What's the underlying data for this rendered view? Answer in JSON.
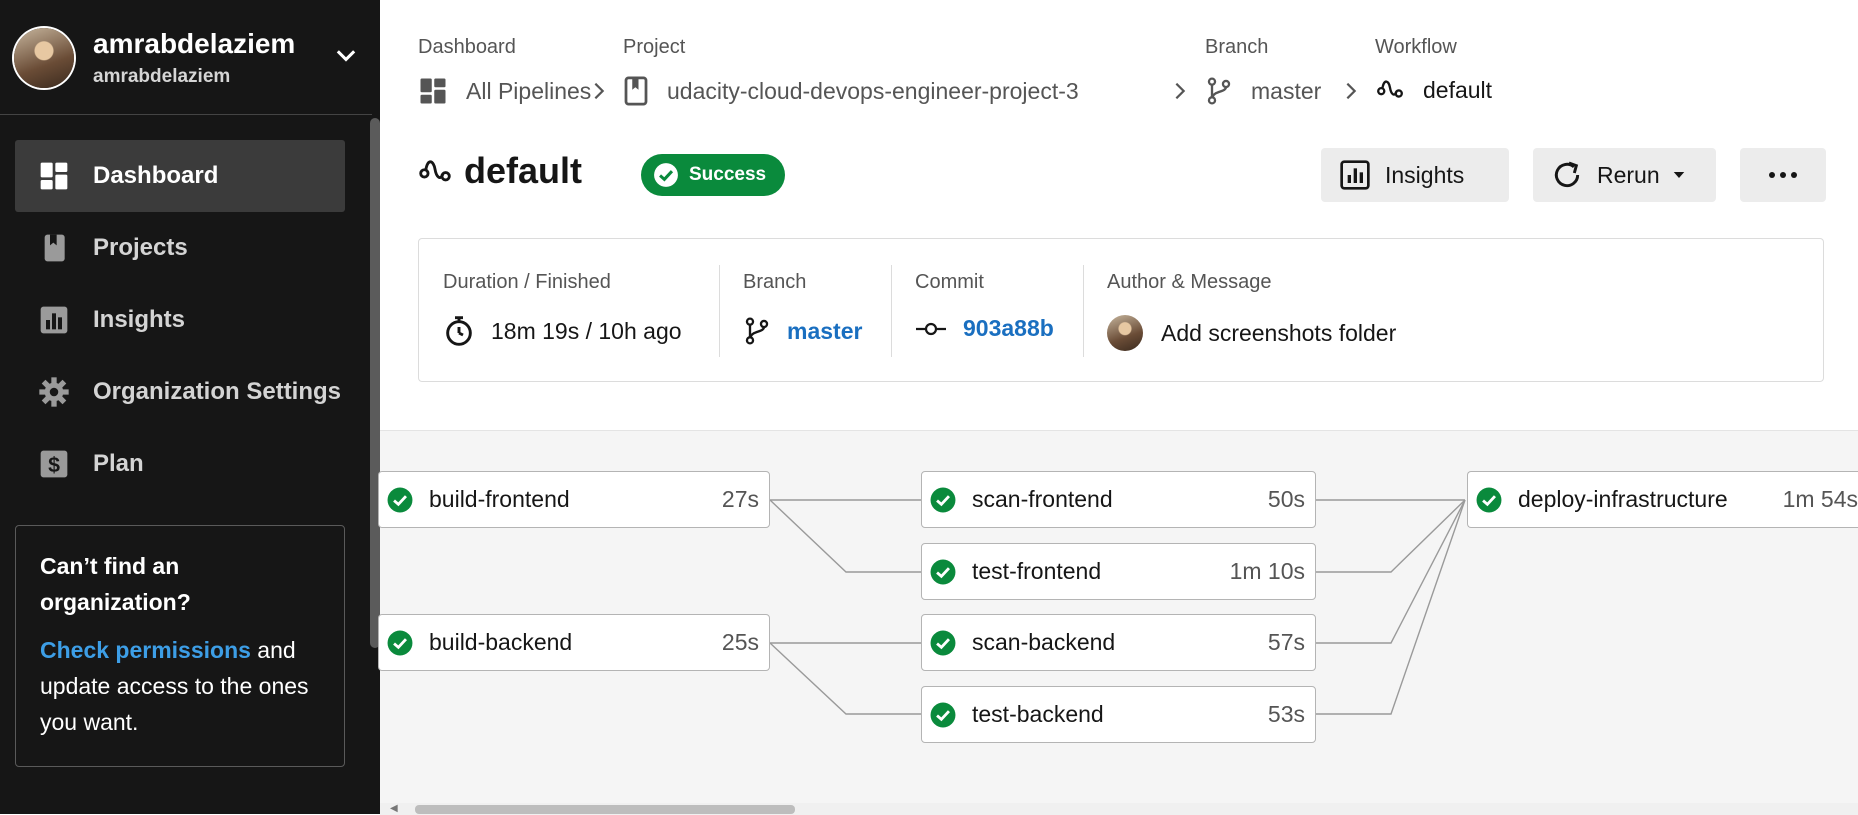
{
  "user": {
    "name": "amrabdelaziem",
    "handle": "amrabdelaziem"
  },
  "sidebar": {
    "items": [
      {
        "label": "Dashboard",
        "icon": "dashboard-icon",
        "active": true
      },
      {
        "label": "Projects",
        "icon": "book-icon"
      },
      {
        "label": "Insights",
        "icon": "bar-chart-icon"
      },
      {
        "label": "Organization Settings",
        "icon": "gear-icon"
      },
      {
        "label": "Plan",
        "icon": "dollar-icon"
      }
    ],
    "help": {
      "title": "Can’t find an organization?",
      "link": "Check permissions",
      "body": " and update access to the ones you want."
    }
  },
  "breadcrumb": {
    "dashboard": {
      "label": "Dashboard",
      "value": "All Pipelines"
    },
    "project": {
      "label": "Project",
      "value": "udacity-cloud-devops-engineer-project-3"
    },
    "branch": {
      "label": "Branch",
      "value": "master"
    },
    "workflow": {
      "label": "Workflow",
      "value": "default"
    }
  },
  "workflow": {
    "title": "default",
    "status": "Success",
    "status_color": "#0a8a3c"
  },
  "actions": {
    "insights": "Insights",
    "rerun": "Rerun",
    "more": "..."
  },
  "info": {
    "duration_label": "Duration / Finished",
    "duration_value": "18m 19s / 10h ago",
    "branch_label": "Branch",
    "branch_value": "master",
    "commit_label": "Commit",
    "commit_value": "903a88b",
    "author_label": "Author & Message",
    "message": "Add screenshots folder"
  },
  "jobs": [
    {
      "name": "build-frontend",
      "duration": "27s",
      "status": "success"
    },
    {
      "name": "build-backend",
      "duration": "25s",
      "status": "success"
    },
    {
      "name": "scan-frontend",
      "duration": "50s",
      "status": "success"
    },
    {
      "name": "test-frontend",
      "duration": "1m 10s",
      "status": "success"
    },
    {
      "name": "scan-backend",
      "duration": "57s",
      "status": "success"
    },
    {
      "name": "test-backend",
      "duration": "53s",
      "status": "success"
    },
    {
      "name": "deploy-infrastructure",
      "duration": "1m 54s",
      "status": "success"
    }
  ],
  "colors": {
    "sidebar_bg": "#161616",
    "success": "#0a8a3c",
    "link": "#1a6fc0"
  }
}
